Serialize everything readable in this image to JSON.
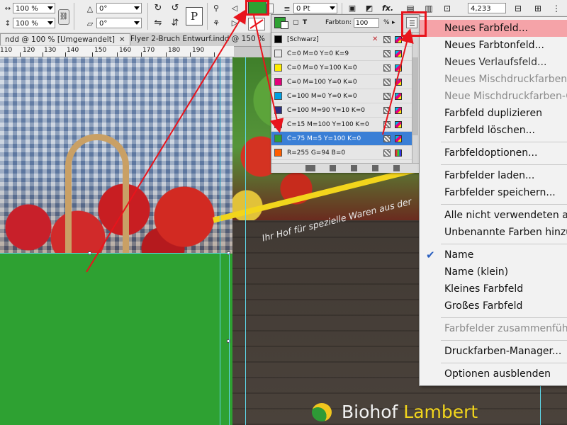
{
  "toolbar": {
    "scale_x": "100 %",
    "scale_y": "100 %",
    "rotate": "0°",
    "shear": "0°",
    "stroke_weight": "0 Pt",
    "dimension": "4,233 mm",
    "fx_label": "fx."
  },
  "tabs": [
    {
      "label": "ndd @ 100 % [Umgewandelt]"
    },
    {
      "label": "Flyer 2-Bruch Entwurf.indd @ 150 %"
    }
  ],
  "ruler": {
    "labels": [
      "110",
      "120",
      "130",
      "140",
      "150",
      "160",
      "170",
      "180",
      "190"
    ]
  },
  "canvas": {
    "slogan": "Ihr Hof für spezielle Waren aus der",
    "logo_name": "Biohof",
    "logo_accent": "Lambert"
  },
  "swatches": {
    "tint_label": "Farbton:",
    "tint_value": "100",
    "tint_unit": "%",
    "rows": [
      {
        "name": "[Schwarz]",
        "color": "#000000"
      },
      {
        "name": "C=0 M=0 Y=0 K=9",
        "color": "#e8e8e8"
      },
      {
        "name": "C=0 M=0 Y=100 K=0",
        "color": "#ffee00"
      },
      {
        "name": "C=0 M=100 Y=0 K=0",
        "color": "#e3007a"
      },
      {
        "name": "C=100 M=0 Y=0 K=0",
        "color": "#00a0e3"
      },
      {
        "name": "C=100 M=90 Y=10 K=0",
        "color": "#2b2f7f"
      },
      {
        "name": "C=15 M=100 Y=100 K=0",
        "color": "#c71d23"
      },
      {
        "name": "C=75 M=5 Y=100 K=0",
        "color": "#2ea132"
      },
      {
        "name": "R=255 G=94 B=0",
        "color": "#ff5e00"
      }
    ],
    "selected_color": "#2ea132"
  },
  "menu": {
    "items": [
      {
        "label": "Neues Farbfeld...",
        "disabled": false
      },
      {
        "label": "Neues Farbtonfeld...",
        "disabled": false
      },
      {
        "label": "Neues Verlaufsfeld...",
        "disabled": false
      },
      {
        "label": "Neues Mischdruckfarben-F",
        "disabled": true
      },
      {
        "label": "Neue Mischdruckfarben-G",
        "disabled": true
      },
      {
        "label": "Farbfeld duplizieren",
        "disabled": false
      },
      {
        "label": "Farbfeld löschen...",
        "disabled": false
      },
      {
        "label": "Farbfeldoptionen...",
        "disabled": false
      },
      {
        "label": "Farbfelder laden...",
        "disabled": false
      },
      {
        "label": "Farbfelder speichern...",
        "disabled": false
      },
      {
        "label": "Alle nicht verwendeten aus",
        "disabled": false
      },
      {
        "label": "Unbenannte Farben hinzuf",
        "disabled": false
      },
      {
        "label": "Name",
        "disabled": false
      },
      {
        "label": "Name (klein)",
        "disabled": false
      },
      {
        "label": "Kleines Farbfeld",
        "disabled": false
      },
      {
        "label": "Großes Farbfeld",
        "disabled": false
      },
      {
        "label": "Farbfelder zusammenführe",
        "disabled": true
      },
      {
        "label": "Druckfarben-Manager...",
        "disabled": false
      },
      {
        "label": "Optionen ausblenden",
        "disabled": false
      }
    ]
  },
  "colors": {
    "highlight": "#f5a3a8",
    "annotation_red": "#e8141c",
    "selection_blue": "#3a7fd6",
    "brand_green": "#2ea132",
    "brand_yellow": "#f2d51c"
  }
}
